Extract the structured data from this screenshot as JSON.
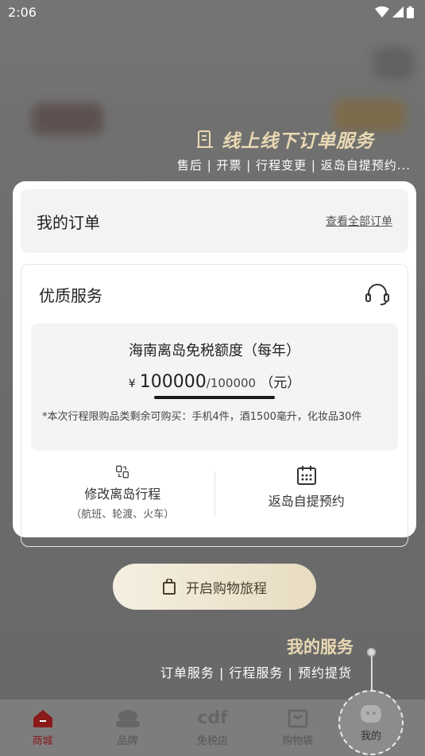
{
  "status_bar": {
    "time": "2:06"
  },
  "promo": {
    "title": "线上线下订单服务",
    "subtitle": "售后 | 开票 | 行程变更 | 返岛自提预约..."
  },
  "orders": {
    "title": "我的订单",
    "view_all": "查看全部订单"
  },
  "service": {
    "title": "优质服务",
    "quota_title": "海南离岛免税额度（每年）",
    "currency": "¥",
    "remaining": "100000",
    "total": "/100000",
    "unit": "（元）",
    "quota_fraction": 1.0,
    "note": "*本次行程限购品类剩余可购买：手机4件，酒1500毫升，化妆品30件",
    "actions": [
      {
        "label": "修改离岛行程",
        "sub": "（航班、轮渡、火车）",
        "icon": "itinerary-icon"
      },
      {
        "label": "返岛自提预约",
        "sub": "",
        "icon": "calendar-icon"
      }
    ]
  },
  "start_button": {
    "label": "开启购物旅程"
  },
  "my_service": {
    "title": "我的服务",
    "subtitle": "订单服务 | 行程服务 | 预约提货"
  },
  "nav": [
    {
      "label": "商城",
      "icon": "home-icon",
      "active": true
    },
    {
      "label": "品牌",
      "icon": "brand-icon",
      "active": false
    },
    {
      "label": "免税店",
      "icon": "cdf-logo-icon",
      "active": false,
      "logo_text": "cdf"
    },
    {
      "label": "购物袋",
      "icon": "bag-icon",
      "active": false
    },
    {
      "label": "我的",
      "icon": "profile-icon",
      "active": false
    }
  ],
  "colors": {
    "accent_gold": "#ead9b3",
    "active_red": "#8a1a1a"
  }
}
